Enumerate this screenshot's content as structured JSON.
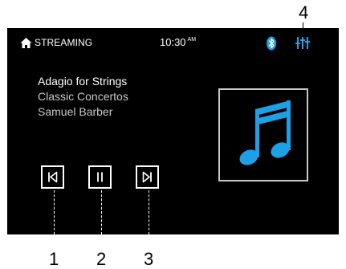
{
  "status_bar": {
    "source_label": "STREAMING",
    "time": "10:30",
    "ampm": "AM"
  },
  "track": {
    "title": "Adagio for Strings",
    "album": "Classic Concertos",
    "artist": "Samuel Barber"
  },
  "controls": [
    "previous-track",
    "pause",
    "next-track"
  ],
  "callouts": [
    "1",
    "2",
    "3",
    "4"
  ],
  "colors": {
    "accent": "#1ea0e6",
    "screen_bg": "#000000",
    "text": "#ffffff",
    "subtext": "#c9c9c9"
  }
}
